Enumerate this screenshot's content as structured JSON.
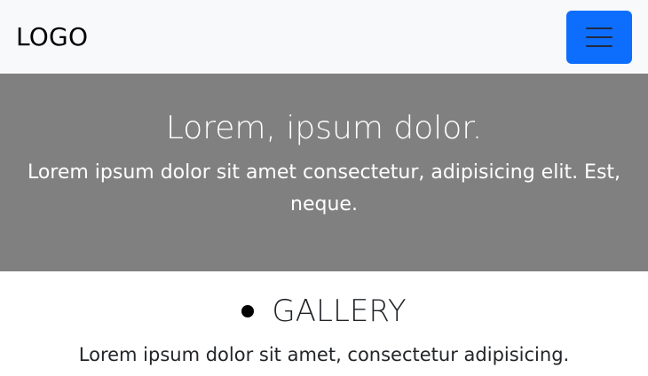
{
  "navbar": {
    "brand": "LOGO",
    "toggler_icon": "hamburger-menu-icon",
    "toggler_color": "#0d6efd"
  },
  "hero": {
    "title": "Lorem, ipsum dolor.",
    "text": "Lorem ipsum dolor sit amet consectetur, adipisicing elit. Est, neque.",
    "background": "#808080"
  },
  "gallery": {
    "heading": "GALLERY",
    "text": "Lorem ipsum dolor sit amet, consectetur adipisicing."
  }
}
